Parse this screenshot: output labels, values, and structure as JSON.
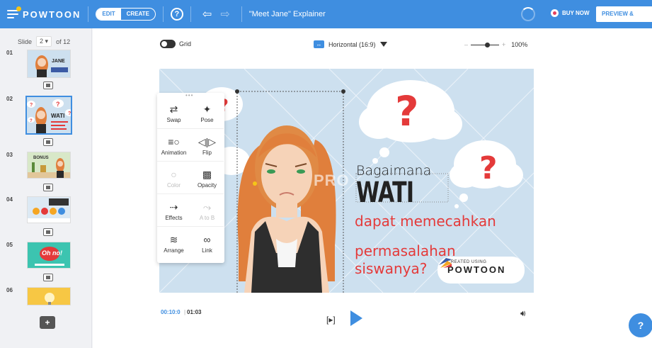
{
  "header": {
    "brand": "POWTOON",
    "mode_edit": "EDIT",
    "mode_create": "CREATE",
    "help": "?",
    "undo_icon": "undo-icon",
    "redo_icon": "redo-icon",
    "title": "\"Meet Jane\" Explainer",
    "buy_now": "BUY NOW",
    "preview_export": "PREVIEW & EXPORT"
  },
  "sidebar": {
    "slide_label": "Slide",
    "current_slide": "2",
    "of_label": "of 12",
    "slides": [
      {
        "num": "01"
      },
      {
        "num": "02"
      },
      {
        "num": "03"
      },
      {
        "num": "04"
      },
      {
        "num": "05"
      },
      {
        "num": "06"
      }
    ],
    "thumb_texts": {
      "s1_name": "JANE",
      "s2_name": "WATI",
      "s3_name": "BONUS",
      "s5_text": "Oh no!"
    },
    "add_slide": "+"
  },
  "toolbar": {
    "grid_label": "Grid",
    "aspect_label": "Horizontal (16:9)",
    "zoom_minus": "–",
    "zoom_plus": "+",
    "zoom_value": "100%"
  },
  "stage": {
    "line1": "Bagaimana",
    "line2": "WATI",
    "line3": "dapat memecahkan",
    "line4": "permasalahan",
    "line5": "siswanya?",
    "pro_watermark": "PRO",
    "watermark_small": "CREATED USING",
    "watermark_big": "POWTOON",
    "colors": {
      "background": "#cde0ef",
      "accent": "#e43a3a",
      "hair": "#e07f3c"
    }
  },
  "panel": {
    "tools": [
      {
        "label": "Swap",
        "icon": "swap-icon",
        "glyph": "⇄"
      },
      {
        "label": "Pose",
        "icon": "pose-icon",
        "glyph": "✦"
      },
      {
        "label": "Animation",
        "icon": "animation-icon",
        "glyph": "≡○"
      },
      {
        "label": "Flip",
        "icon": "flip-icon",
        "glyph": "◁|▷"
      },
      {
        "label": "Color",
        "icon": "color-icon",
        "glyph": "○"
      },
      {
        "label": "Opacity",
        "icon": "opacity-icon",
        "glyph": "▩"
      },
      {
        "label": "Effects",
        "icon": "effects-icon",
        "glyph": "⇢"
      },
      {
        "label": "A to B",
        "icon": "a-to-b-icon",
        "glyph": "⤳"
      },
      {
        "label": "Arrange",
        "icon": "arrange-icon",
        "glyph": "≋"
      },
      {
        "label": "Link",
        "icon": "link-icon",
        "glyph": "🔗"
      }
    ]
  },
  "timeline": {
    "current": "00:10:0",
    "divider": "|",
    "total": "01:03",
    "bracket": "[▸]"
  },
  "help_bubble": "?"
}
